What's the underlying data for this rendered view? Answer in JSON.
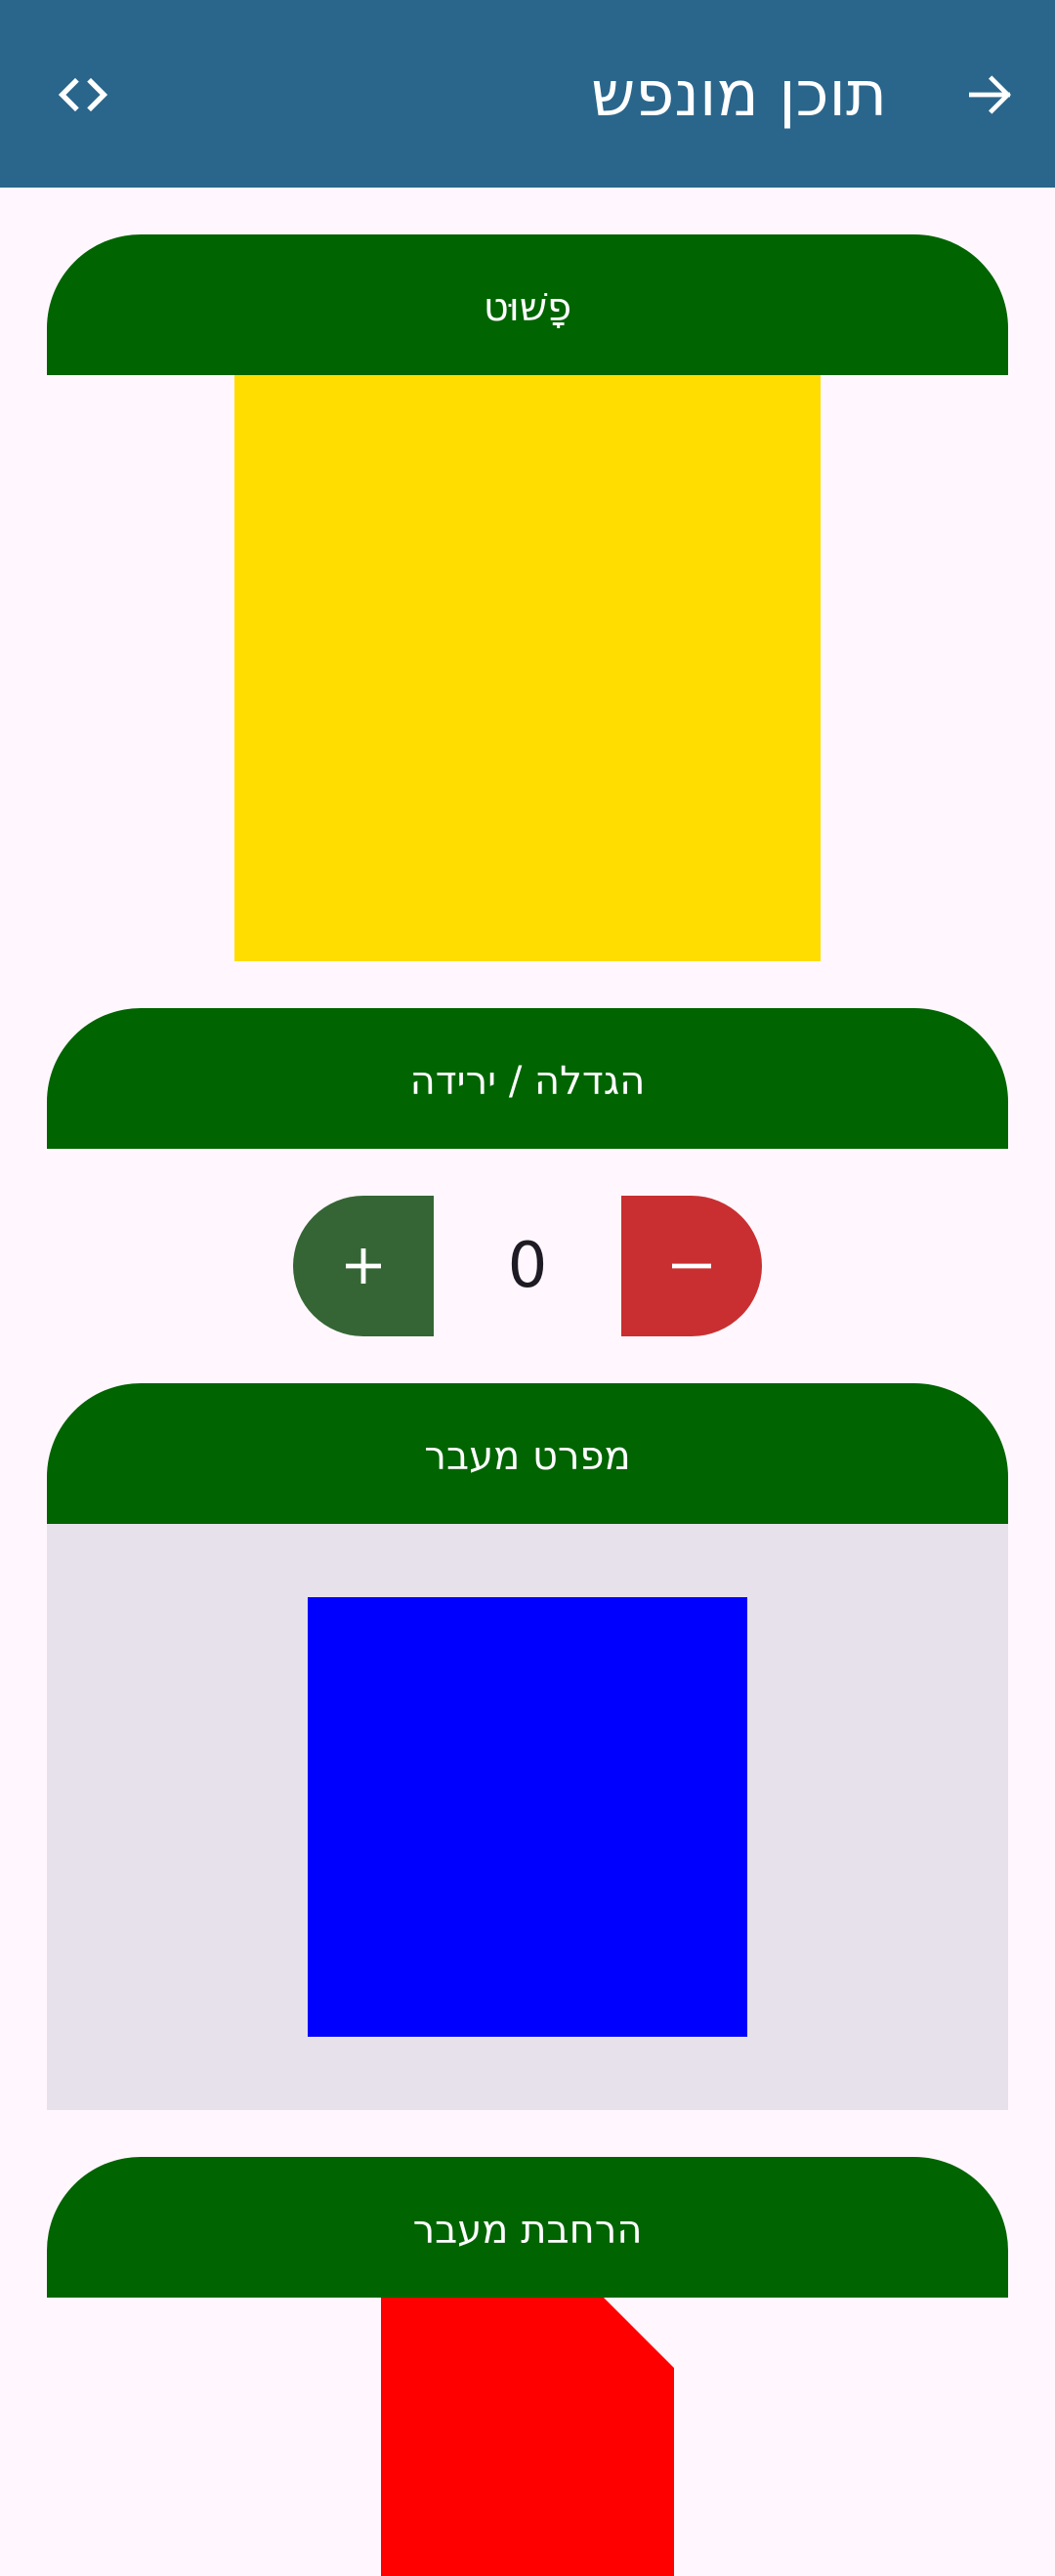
{
  "app_bar": {
    "title": "תוכן מונפש",
    "back_icon": "arrow-forward-icon",
    "code_icon": "code-icon",
    "background_color": "#2a668c"
  },
  "sections": {
    "simple": {
      "title": "פָשׁוּט",
      "box_color": "#ffdd00"
    },
    "increase_decrease": {
      "title": "הגדלה / ירידה"
    },
    "transition_spec": {
      "title": "מפרט מעבר",
      "box_color": "#0000ff",
      "panel_color": "#e6e1ea"
    },
    "transition_expansion": {
      "title": "הרחבת מעבר",
      "shape_color": "#ff0000"
    }
  },
  "counter": {
    "value": "0",
    "plus_label": "+",
    "minus_label": "−",
    "plus_color": "#356535",
    "minus_color": "#c92f31"
  },
  "header_color": "#006400"
}
